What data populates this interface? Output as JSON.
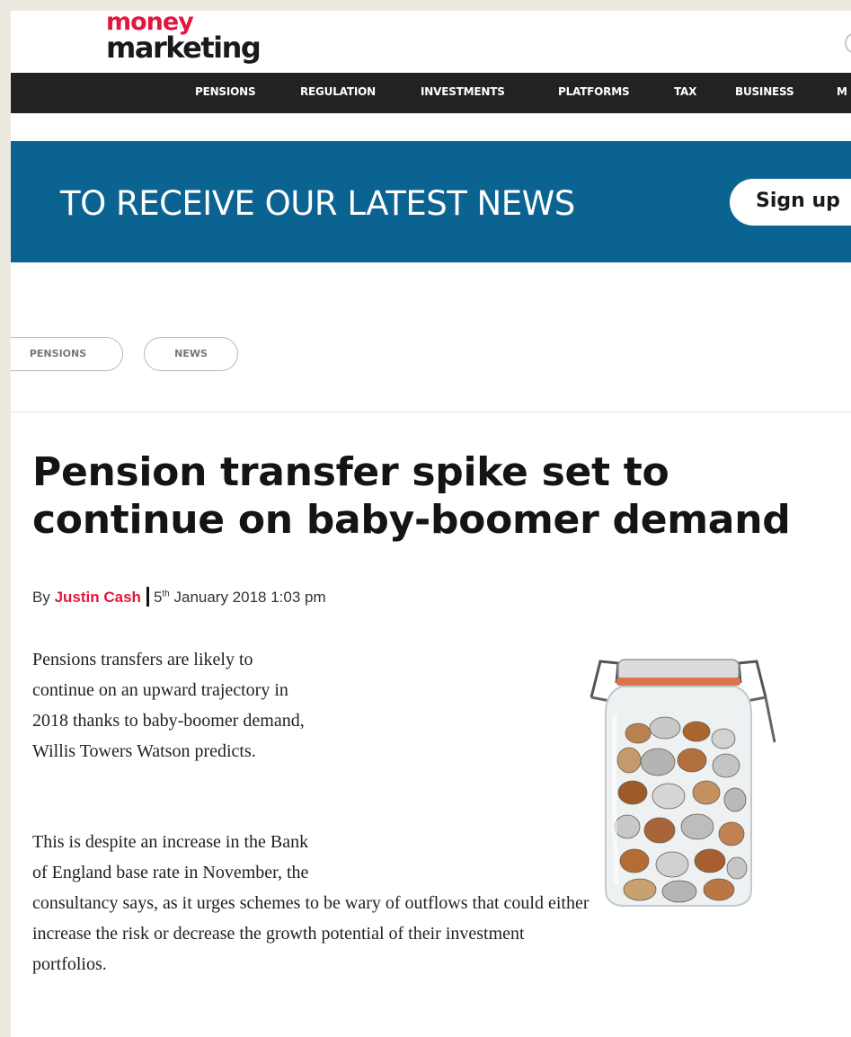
{
  "header": {
    "logo_top": "money",
    "logo_bottom": "marketing",
    "nav": [
      "PENSIONS",
      "REGULATION",
      "INVESTMENTS",
      "PLATFORMS",
      "TAX",
      "BUSINESS",
      "M"
    ]
  },
  "banner": {
    "text": "TO RECEIVE OUR LATEST NEWS",
    "button": "Sign up"
  },
  "tags": [
    "PENSIONS",
    "NEWS"
  ],
  "article": {
    "title_line1": "Pension transfer spike set to",
    "title_line2": "continue on baby-boomer demand",
    "by": "By",
    "author": "Justin Cash",
    "date_day": "5",
    "date_suffix": "th",
    "date_rest": "January 2018 1:03 pm",
    "p1_lines": [
      "Pensions transfers are likely to",
      "continue on an upward trajectory in",
      "2018 thanks to baby-boomer demand,",
      "Willis Towers Watson predicts."
    ],
    "p2_lines": [
      "This is despite an increase in the Bank",
      "of England base rate in November, the",
      "consultancy says, as it urges schemes to be wary of outflows that could either",
      "increase the risk or decrease the growth potential of their investment",
      "portfolios."
    ]
  },
  "colors": {
    "brand_red": "#e3173e",
    "nav_bg": "#222222",
    "banner_blue": "#0b6392"
  },
  "icons": [
    "search-icon",
    "coin-jar-image"
  ]
}
